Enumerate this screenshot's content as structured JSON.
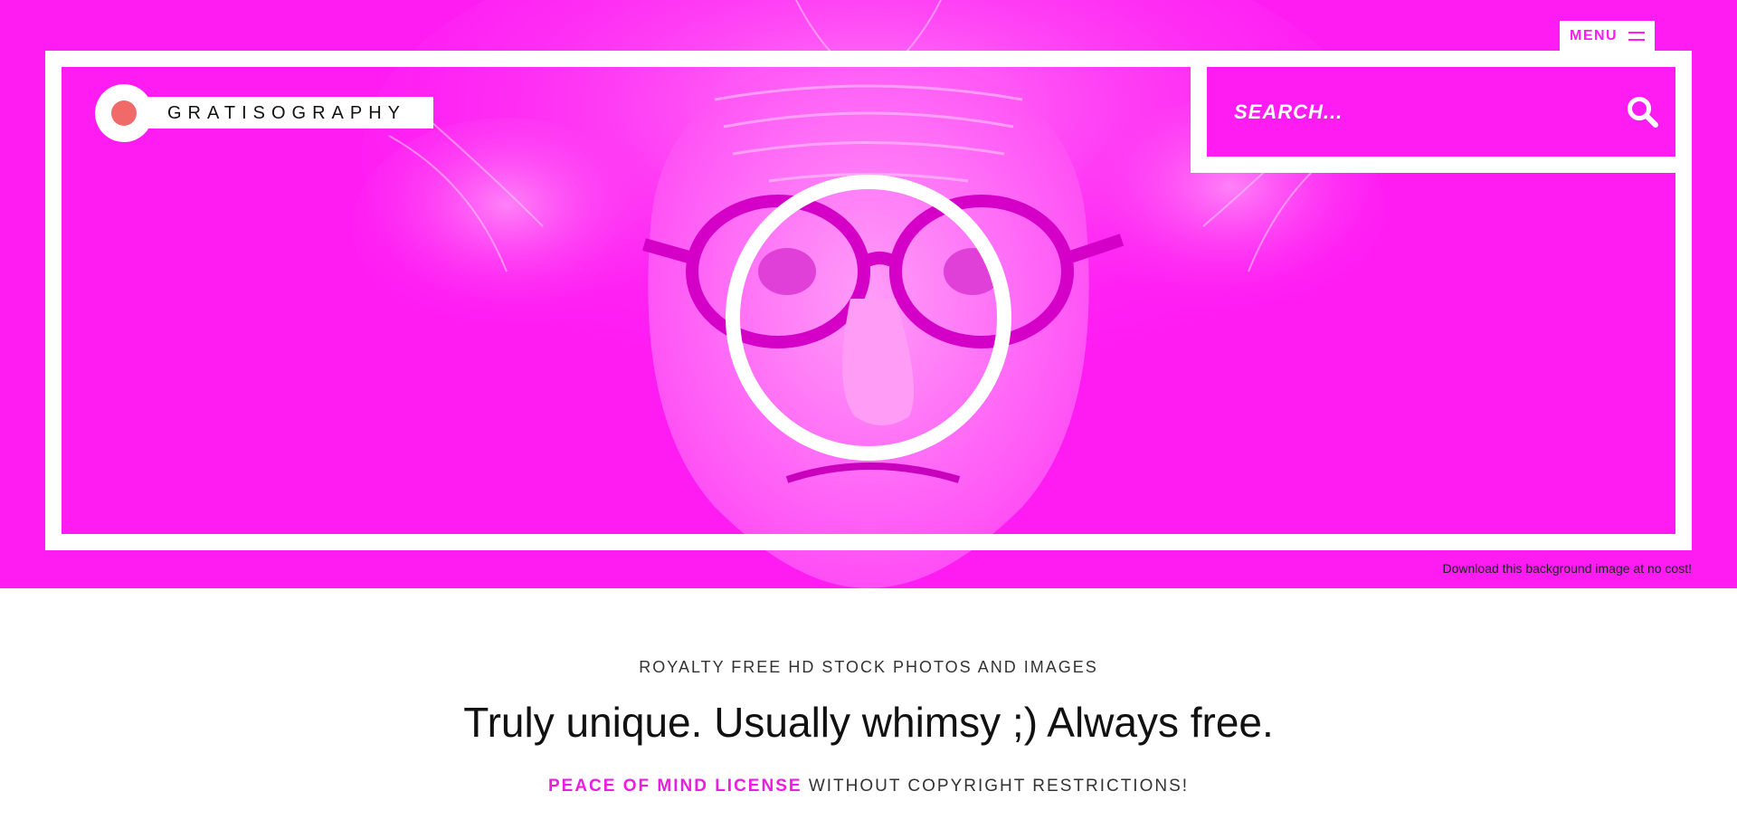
{
  "header": {
    "logo_text": "GRATISOGRAPHY",
    "menu_label": "MENU",
    "search_placeholder": "SEARCH..."
  },
  "hero": {
    "download_text": "Download this background image at no cost!"
  },
  "main": {
    "tagline": "ROYALTY FREE HD STOCK PHOTOS AND IMAGES",
    "headline": "Truly unique. Usually whimsy ;) Always free.",
    "license_link": "PEACE OF MIND LICENSE",
    "license_rest": "WITHOUT COPYRIGHT RESTRICTIONS!"
  },
  "icons": {
    "menu": "hamburger-icon",
    "search": "search-icon",
    "logo": "logo-dot-icon"
  },
  "colors": {
    "brand_magenta": "#ff1cf3",
    "link_magenta": "#e91ee0",
    "logo_dot": "#f06a6a",
    "frame": "#ffffff"
  }
}
